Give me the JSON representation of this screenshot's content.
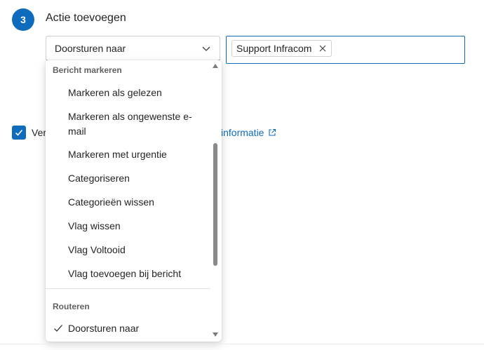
{
  "step": {
    "number": "3",
    "title": "Actie toevoegen"
  },
  "action_select": {
    "value": "Doorsturen naar"
  },
  "recipient": {
    "chip_label": "Support Infracom"
  },
  "options_checkbox": {
    "label": "Ver",
    "checked": true,
    "more_info_link": "informatie"
  },
  "dropdown": {
    "groups": [
      {
        "header": "Bericht markeren",
        "items": [
          "Markeren als gelezen",
          "Markeren als ongewenste e-mail",
          "Markeren met urgentie",
          "Categoriseren",
          "Categorieën wissen",
          "Vlag wissen",
          "Vlag Voltooid",
          "Vlag toevoegen bij bericht"
        ]
      },
      {
        "header": "Routeren",
        "items": [
          "Doorsturen naar"
        ]
      }
    ],
    "selected_item": "Doorsturen naar"
  },
  "colors": {
    "accent": "#0f6cbd",
    "text": "#242424",
    "muted": "#616161"
  }
}
